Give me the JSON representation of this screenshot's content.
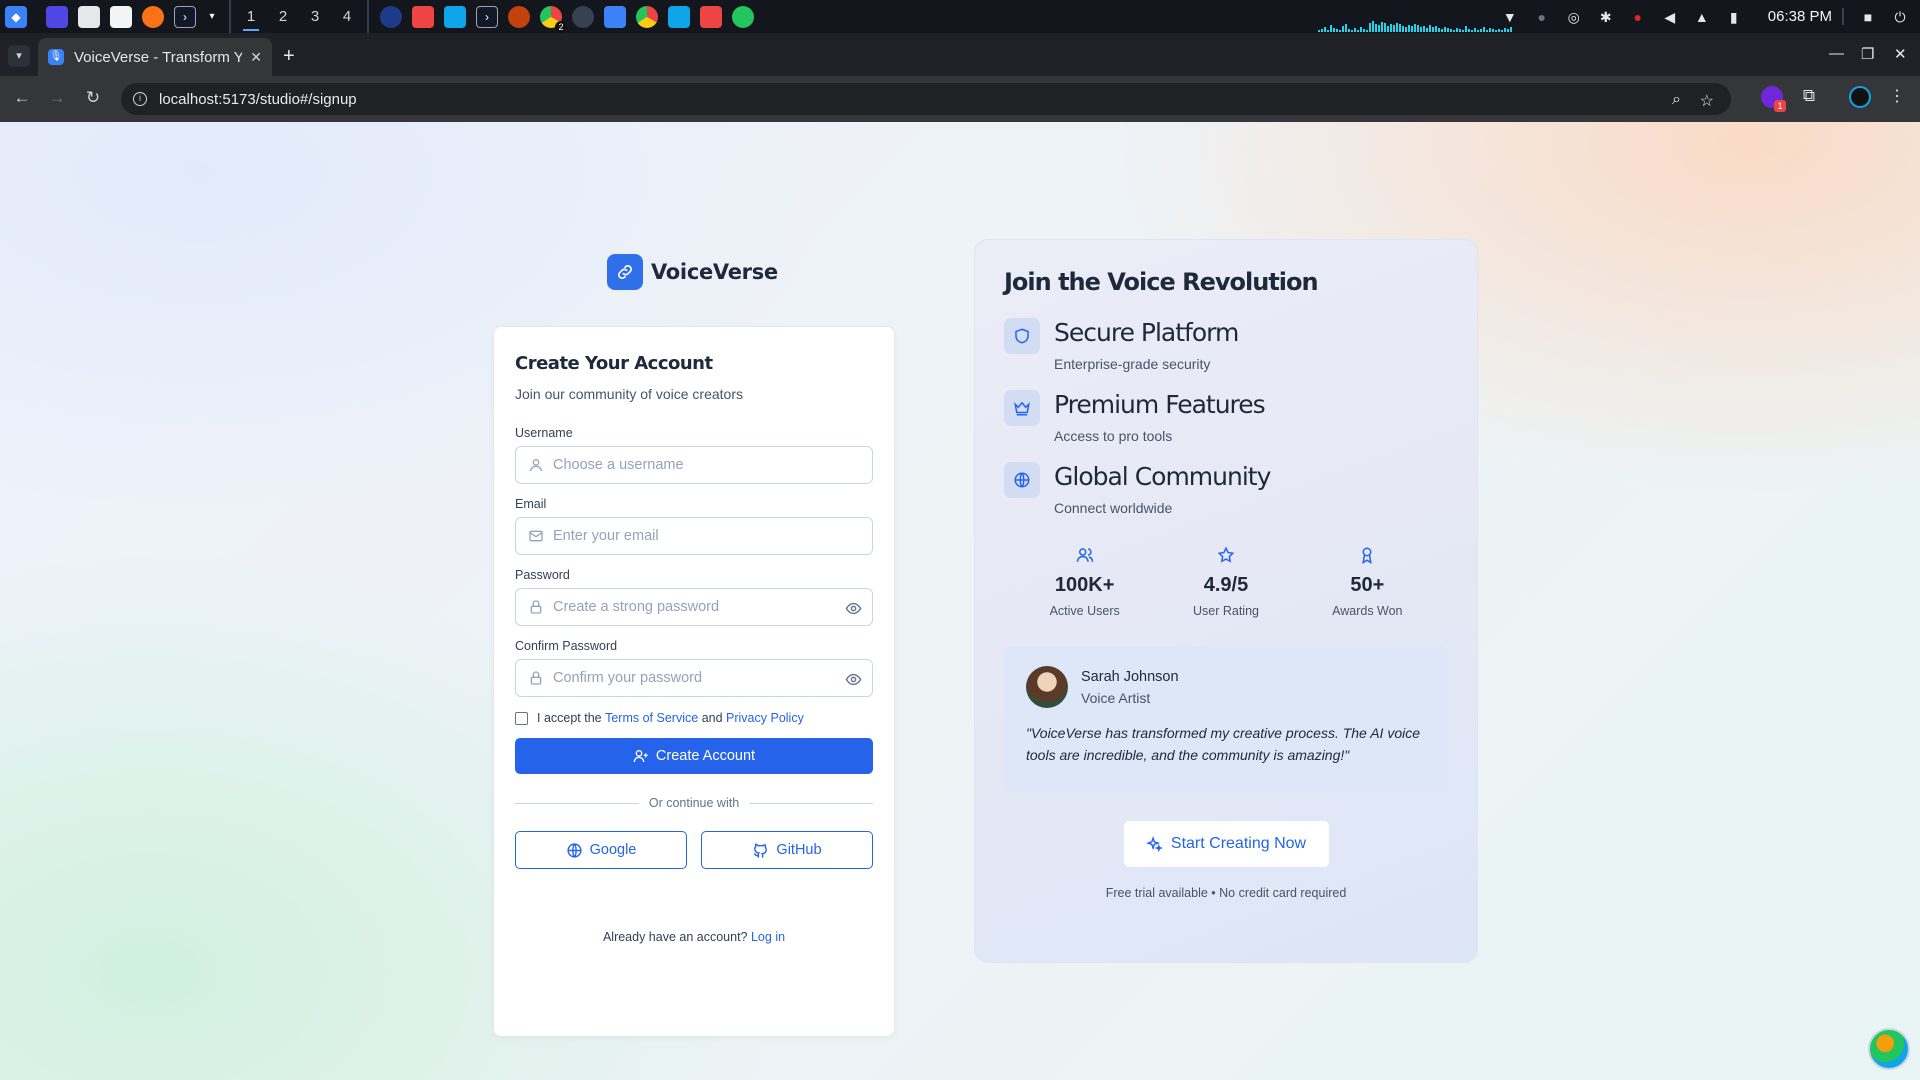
{
  "taskbar": {
    "workspaces": [
      "1",
      "2",
      "3",
      "4"
    ],
    "active_workspace": "1",
    "notification_badge": "2",
    "clock": "06:38 PM"
  },
  "browser": {
    "tab_title": "VoiceVerse - Transform Y",
    "url": "localhost:5173/studio#/signup",
    "extension_badge": "1"
  },
  "brand": {
    "name": "VoiceVerse"
  },
  "signup": {
    "title": "Create Your Account",
    "subtitle": "Join our community of voice creators",
    "fields": [
      {
        "label": "Username",
        "placeholder": "Choose a username",
        "icon": "user-icon"
      },
      {
        "label": "Email",
        "placeholder": "Enter your email",
        "icon": "mail-icon"
      },
      {
        "label": "Password",
        "placeholder": "Create a strong password",
        "icon": "lock-icon"
      },
      {
        "label": "Confirm Password",
        "placeholder": "Confirm your password",
        "icon": "lock-icon"
      }
    ],
    "terms_prefix": "I accept the",
    "terms_link": "Terms of Service",
    "terms_and": "and",
    "privacy_link": "Privacy Policy",
    "submit_label": "Create Account",
    "divider_text": "Or continue with",
    "google_label": "Google",
    "github_label": "GitHub",
    "login_prompt": "Already have an account?",
    "login_link": "Log in"
  },
  "panel": {
    "title": "Join the Voice Revolution",
    "features": [
      {
        "title": "Secure Platform",
        "desc": "Enterprise-grade security",
        "icon": "shield-icon"
      },
      {
        "title": "Premium Features",
        "desc": "Access to pro tools",
        "icon": "crown-icon"
      },
      {
        "title": "Global Community",
        "desc": "Connect worldwide",
        "icon": "globe-icon"
      }
    ],
    "stats": [
      {
        "value": "100K+",
        "label": "Active Users",
        "icon": "users-icon"
      },
      {
        "value": "4.9/5",
        "label": "User Rating",
        "icon": "star-icon"
      },
      {
        "value": "50+",
        "label": "Awards Won",
        "icon": "award-icon"
      }
    ],
    "testimonial": {
      "name": "Sarah Johnson",
      "role": "Voice Artist",
      "quote": "\"VoiceVerse has transformed my creative process. The AI voice tools are incredible, and the community is amazing!\""
    },
    "cta_label": "Start Creating Now",
    "note": "Free trial available • No credit card required"
  },
  "colors": {
    "accent": "#2563eb",
    "brand_logo": "#2f6fea",
    "text_dark": "#1e293b"
  }
}
